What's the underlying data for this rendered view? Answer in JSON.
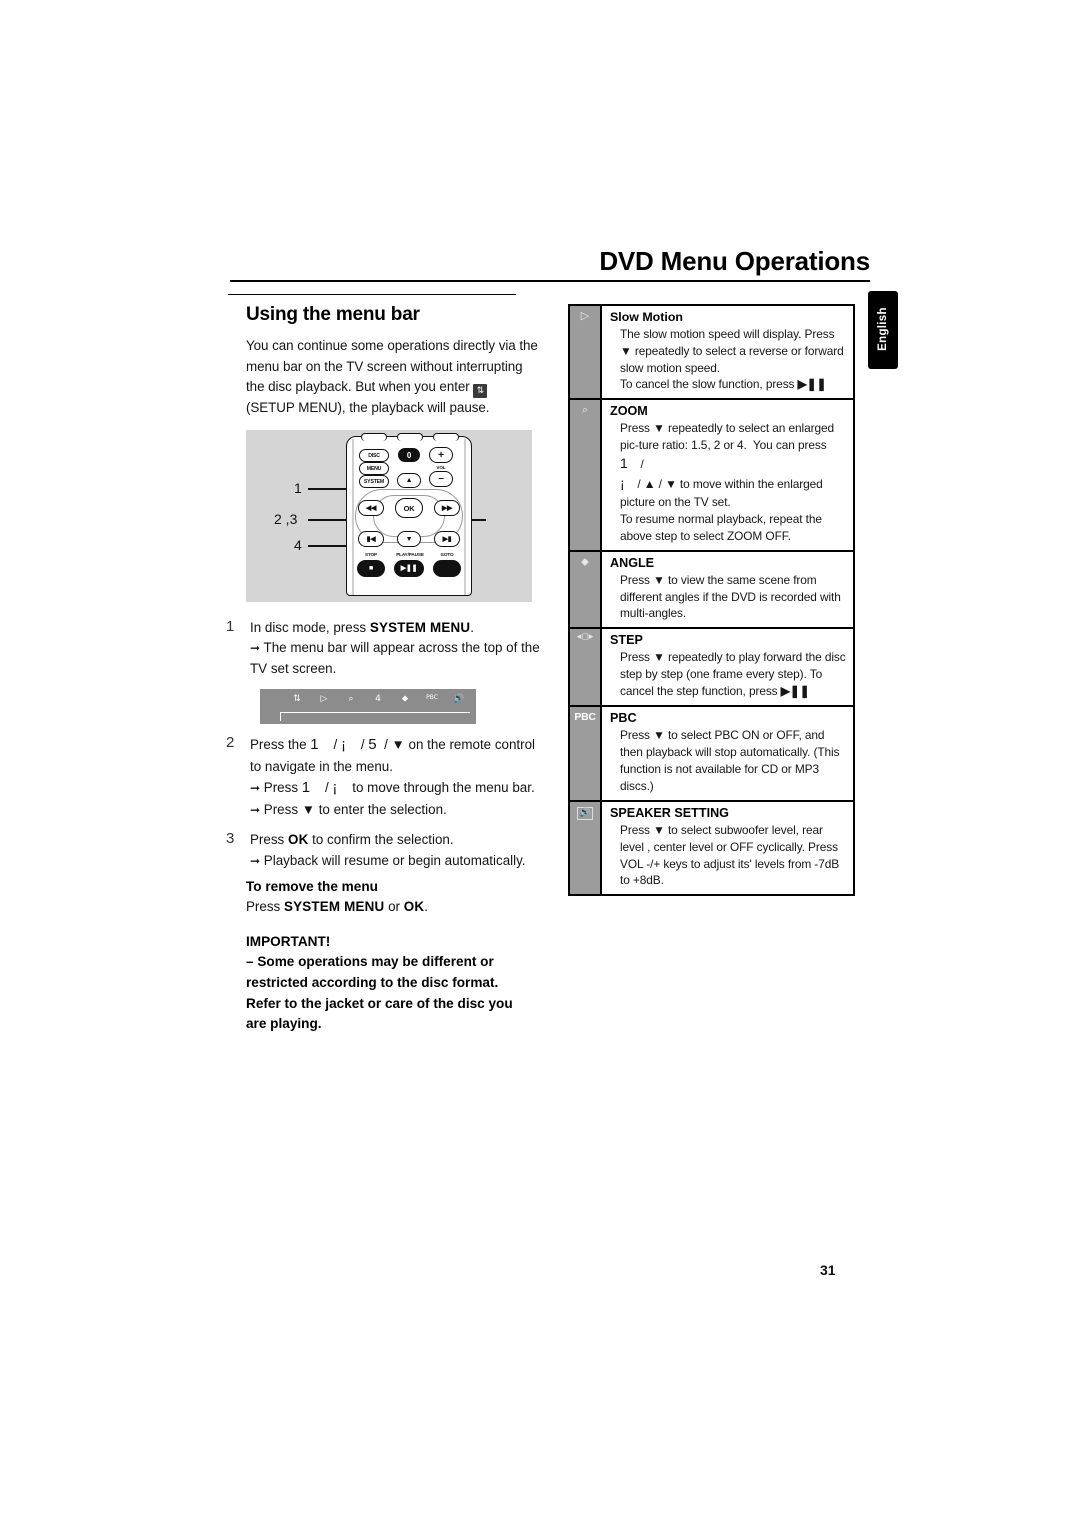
{
  "page": {
    "title": "DVD Menu Operations",
    "number": "31",
    "side_tab": "English"
  },
  "left": {
    "section_title": "Using the menu bar",
    "intro_before_icon": "You can continue some operations directly via the menu bar on the TV screen without interrupting the disc playback. But when you enter",
    "setup_icon": "setup-menu-icon",
    "intro_after_icon": "(SETUP MENU), the playback will pause.",
    "steps": [
      {
        "num": "1",
        "lines": [
          "In disc mode, press SYSTEM MENU.",
          "→ The menu bar will appear across the top of the TV set screen."
        ]
      },
      {
        "num": "2",
        "lines": [
          "Press the 1    / ¡    / 5  / ▼ on the remote control to navigate in the menu.",
          "→ Press 1    / ¡    to move through the menu bar.",
          "→ Press ▼ to enter the selection."
        ]
      },
      {
        "num": "3",
        "lines": [
          "Press OK to confirm the selection.",
          "→ Playback will resume or begin automatically."
        ]
      }
    ],
    "menubar_icons": [
      "↑↓",
      "▷",
      "⌕",
      "4",
      "⬥",
      "PBC",
      "⧏))"
    ],
    "remove_menu": {
      "heading": "To remove the menu",
      "line": "Press SYSTEM MENU or OK."
    },
    "important": {
      "heading": "IMPORTANT!",
      "body": "–  Some operations may be different or restricted according to the disc format. Refer to the jacket or care of the disc you are playing."
    }
  },
  "remote": {
    "callouts": [
      "1",
      "2 ,3",
      "4"
    ],
    "buttons": [
      {
        "name": "disc-button",
        "label": "DISC"
      },
      {
        "name": "menu-button",
        "label": "MENU"
      },
      {
        "name": "system-button",
        "label": "SYSTEM"
      },
      {
        "name": "zero-button",
        "label": "0"
      },
      {
        "name": "vol-up-button",
        "label": "+"
      },
      {
        "name": "vol-label",
        "label": "VOL"
      },
      {
        "name": "vol-down-button",
        "label": "–"
      },
      {
        "name": "up-button",
        "label": "▲"
      },
      {
        "name": "rewind-button",
        "label": "◀◀"
      },
      {
        "name": "ok-button",
        "label": "OK"
      },
      {
        "name": "forward-button",
        "label": "▶▶"
      },
      {
        "name": "prev-button",
        "label": "▮◀"
      },
      {
        "name": "down-button",
        "label": "▼"
      },
      {
        "name": "next-button",
        "label": "▶▮"
      },
      {
        "name": "stop-button",
        "label": "STOP"
      },
      {
        "name": "play-pause-button",
        "label": "PLAY/PAUSE"
      },
      {
        "name": "goto-button",
        "label": "GOTO"
      }
    ]
  },
  "table": {
    "rows": [
      {
        "icon": "slow-motion-icon",
        "icon_glyph": "▷",
        "name": "Slow Motion",
        "desc": "The slow motion speed will display. Press ▼ repeatedly to select a reverse or forward slow motion speed. To cancel the slow function, press ▶❙❙"
      },
      {
        "icon": "zoom-icon",
        "icon_glyph": "⌕",
        "name": "ZOOM",
        "desc": "Press ▼ repeatedly to select an enlarged picture ratio: 1.5, 2 or 4.  You can press 1    /  ¡    / ▲ / ▼ to move within the enlarged picture on the TV set. To resume normal playback, repeat the above step to select ZOOM OFF."
      },
      {
        "icon": "angle-icon",
        "icon_glyph": "⬥",
        "name": "ANGLE",
        "desc": "Press ▼ to view the same scene from different angles  if the DVD is recorded with multi-angles."
      },
      {
        "icon": "step-icon",
        "icon_glyph": "▮▯▮",
        "name": "STEP",
        "desc": "Press ▼ repeatedly to play forward the disc step by step (one frame every step). To cancel the step function, press ▶❙❙"
      },
      {
        "icon": "pbc-icon",
        "icon_glyph": "PBC",
        "name": "PBC",
        "desc": "Press ▼ to select PBC ON or OFF, and then playback will stop automatically. (This function is not available for CD or MP3 discs.)"
      },
      {
        "icon": "speaker-setting-icon",
        "icon_glyph": "⧏))",
        "name": "SPEAKER SETTING",
        "desc": "Press ▼ to select subwoofer level, rear level , center level or OFF cyclically.  Press VOL -/+ keys to adjust its' levels from -7dB to +8dB."
      }
    ]
  }
}
